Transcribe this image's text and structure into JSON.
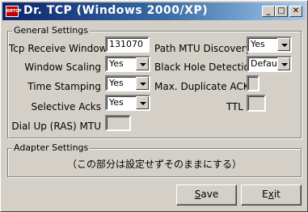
{
  "window": {
    "title": "Dr. TCP (Windows 2000/XP)",
    "icon_label": "DRTCP",
    "controls": {
      "minimize": "_",
      "maximize": "□",
      "close": "✕"
    }
  },
  "general": {
    "label": "General Settings",
    "tcp_receive_window": {
      "label": "Tcp Receive Window",
      "value": "131070"
    },
    "window_scaling": {
      "label": "Window Scaling",
      "value": "Yes"
    },
    "time_stamping": {
      "label": "Time Stamping",
      "value": "Yes"
    },
    "selective_acks": {
      "label": "Selective Acks",
      "value": "Yes"
    },
    "dial_up_mtu": {
      "label": "Dial Up (RAS) MTU",
      "value": ""
    },
    "path_mtu_discovery": {
      "label": "Path MTU Discovery",
      "value": "Yes"
    },
    "black_hole_detection": {
      "label": "Black Hole Detection",
      "value": "Defaul"
    },
    "max_duplicate_acks": {
      "label": "Max. Duplicate ACKs",
      "value": ""
    },
    "ttl": {
      "label": "TTL",
      "value": ""
    }
  },
  "adapter": {
    "label": "Adapter Settings",
    "note": "（この部分は設定せずそのままにする）"
  },
  "buttons": {
    "save_pre": "",
    "save_key": "S",
    "save_post": "ave",
    "exit_pre": "E",
    "exit_key": "x",
    "exit_post": "it"
  }
}
